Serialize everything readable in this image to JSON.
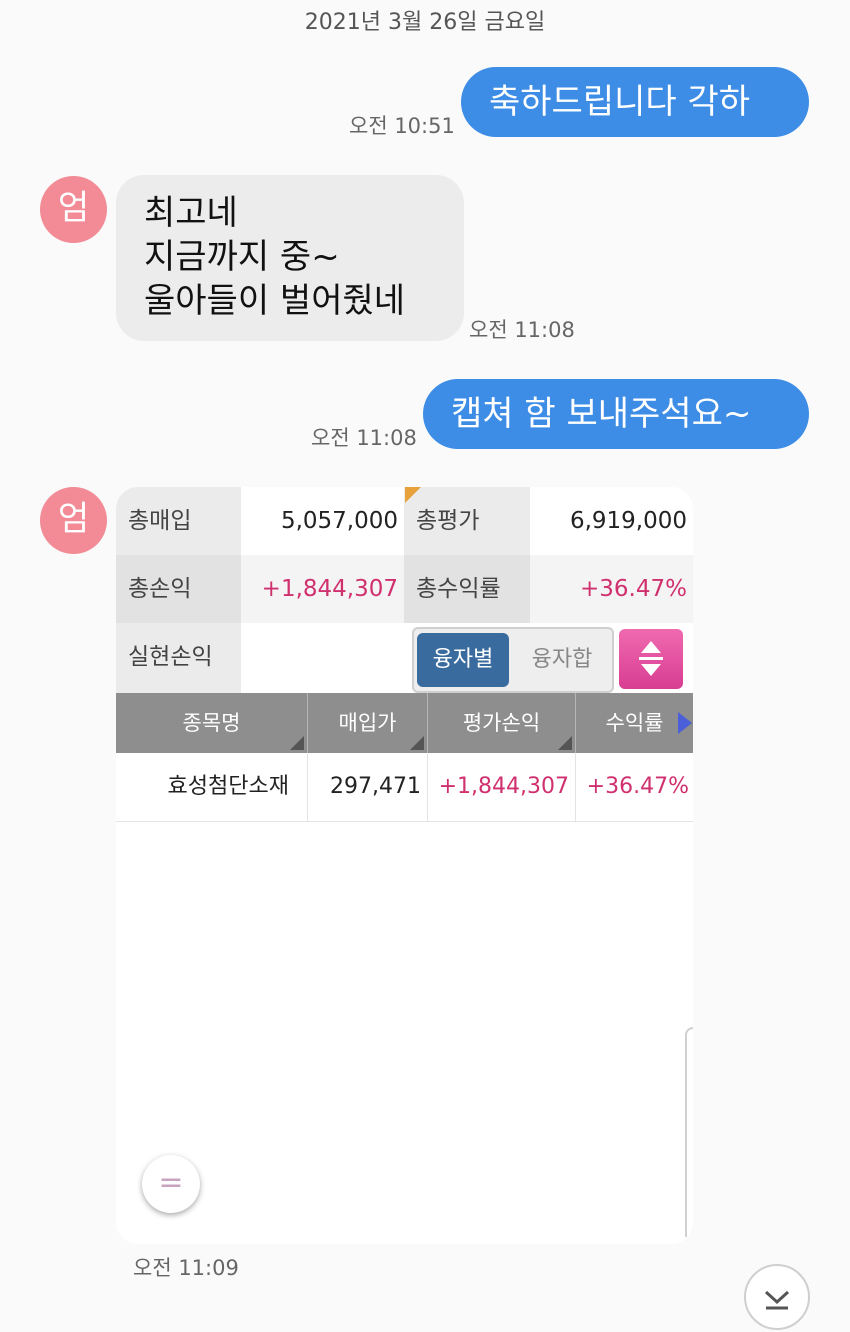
{
  "date_header": "2021년 3월 26일 금요일",
  "messages": [
    {
      "direction": "out",
      "text": "축하드립니다 각하",
      "time": "오전 10:51"
    },
    {
      "direction": "in",
      "sender_avatar": "엄",
      "lines": [
        "최고네",
        "지금까지 중~",
        "울아들이 벌어줬네"
      ],
      "time": "오전 11:08"
    },
    {
      "direction": "out",
      "text": "캡쳐 함 보내주석요~",
      "time": "오전 11:08"
    },
    {
      "direction": "in",
      "sender_avatar": "엄",
      "type": "image",
      "time": "오전 11:09"
    }
  ],
  "screenshot": {
    "summary": {
      "total_purchase_label": "총매입",
      "total_purchase_value": "5,057,000",
      "total_eval_label": "총평가",
      "total_eval_value": "6,919,000",
      "total_pnl_label": "총손익",
      "total_pnl_value": "+1,844,307",
      "total_return_label": "총수익률",
      "total_return_value": "+36.47%",
      "realized_label": "실현손익",
      "realized_value": ""
    },
    "toggle": {
      "selected": "융자별",
      "other": "융자합"
    },
    "table": {
      "headers": [
        "종목명",
        "매입가",
        "평가손익",
        "수익률"
      ],
      "rows": [
        {
          "name": "효성첨단소재",
          "buy_price": "297,471",
          "pnl": "+1,844,307",
          "return": "+36.47%"
        }
      ]
    },
    "fab_label": "="
  },
  "colors": {
    "outgoing_bubble": "#3d8ce6",
    "incoming_bubble": "#ececec",
    "avatar": "#f28b95",
    "gain": "#d0306e",
    "toggle_selected": "#3a6b9e",
    "sort_button": "#e04f9f"
  },
  "icons": {
    "sort": "up-down-arrows-icon",
    "scroll_down": "chevron-down-icon",
    "table_next": "triangle-right-icon"
  }
}
